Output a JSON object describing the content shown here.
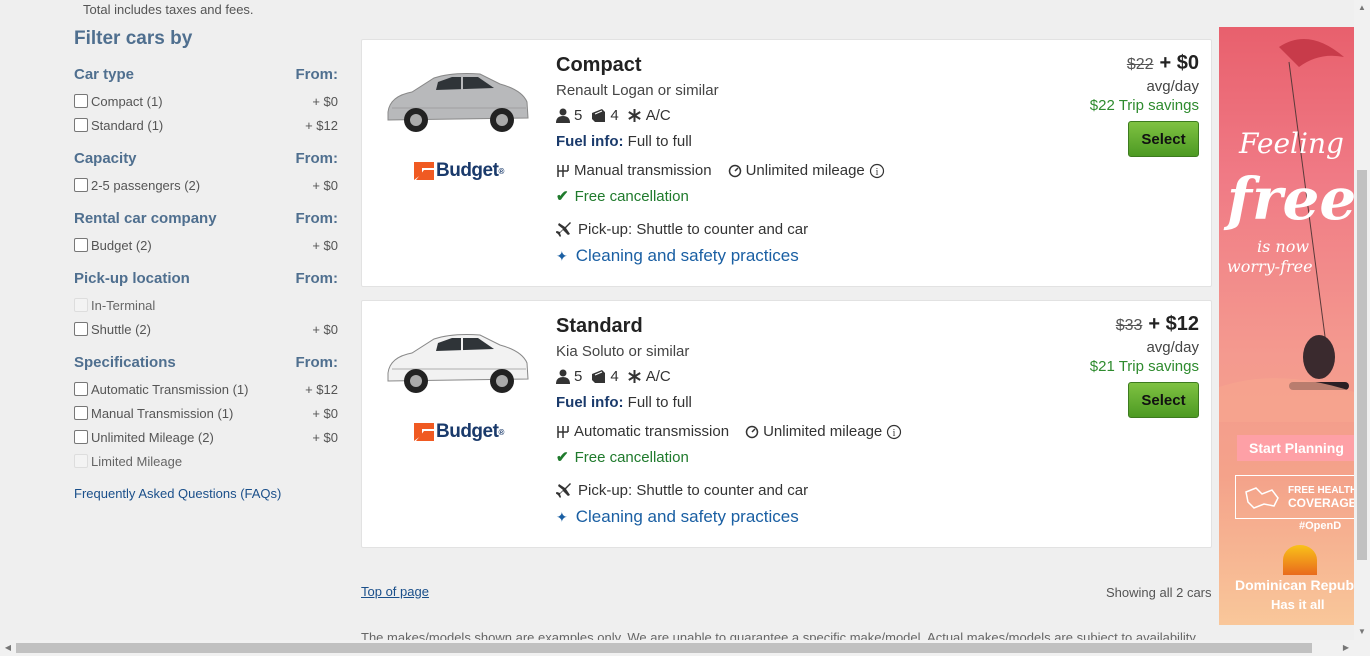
{
  "page": {
    "top_note": "Total includes taxes and fees.",
    "top_link": "Top of page",
    "showing": "Showing all 2 cars",
    "disclaimer": "The makes/models shown are examples only. We are unable to guarantee a specific make/model. Actual makes/models are subject to availability."
  },
  "sidebar": {
    "title": "Filter cars by",
    "faq": "Frequently Asked Questions (FAQs)",
    "groups": [
      {
        "label": "Car type",
        "from": "From:",
        "options": [
          {
            "label": "Compact (1)",
            "price": "+ $0"
          },
          {
            "label": "Standard (1)",
            "price": "+ $12"
          }
        ]
      },
      {
        "label": "Capacity",
        "from": "From:",
        "options": [
          {
            "label": "2-5 passengers (2)",
            "price": "+ $0"
          }
        ]
      },
      {
        "label": "Rental car company",
        "from": "From:",
        "options": [
          {
            "label": "Budget (2)",
            "price": "+ $0"
          }
        ]
      },
      {
        "label": "Pick-up location",
        "from": "From:",
        "options": [
          {
            "label": "In-Terminal",
            "price": ""
          },
          {
            "label": "Shuttle (2)",
            "price": "+ $0"
          }
        ]
      },
      {
        "label": "Specifications",
        "from": "From:",
        "options": [
          {
            "label": "Automatic Transmission (1)",
            "price": "+ $12"
          },
          {
            "label": "Manual Transmission (1)",
            "price": "+ $0"
          },
          {
            "label": "Unlimited Mileage (2)",
            "price": "+ $0"
          },
          {
            "label": "Limited Mileage",
            "price": ""
          }
        ]
      }
    ]
  },
  "cars": [
    {
      "category": "Compact",
      "model": "Renault Logan or similar",
      "passengers": "5",
      "bags": "4",
      "ac": "A/C",
      "fuel_label": "Fuel info:",
      "fuel_value": "Full to full",
      "transmission": "Manual transmission",
      "mileage": "Unlimited mileage",
      "cancellation": "Free cancellation",
      "pickup": "Pick-up: Shuttle to counter and car",
      "cleaning": "Cleaning and safety practices",
      "old_price": "$22",
      "new_price": "+ $0",
      "per": "avg/day",
      "savings": "$22 Trip savings",
      "select": "Select",
      "brand": "Budget",
      "car_color": "#b8b9bb"
    },
    {
      "category": "Standard",
      "model": "Kia Soluto or similar",
      "passengers": "5",
      "bags": "4",
      "ac": "A/C",
      "fuel_label": "Fuel info:",
      "fuel_value": "Full to full",
      "transmission": "Automatic transmission",
      "mileage": "Unlimited mileage",
      "cancellation": "Free cancellation",
      "pickup": "Pick-up: Shuttle to counter and car",
      "cleaning": "Cleaning and safety practices",
      "old_price": "$33",
      "new_price": "+ $12",
      "per": "avg/day",
      "savings": "$21 Trip savings",
      "select": "Select",
      "brand": "Budget",
      "car_color": "#f2f2f2"
    }
  ],
  "ad": {
    "line1": "Feeling",
    "line2": "free",
    "line3": "is now",
    "line4": "worry-free",
    "cta": "Start Planning",
    "coverage1": "FREE HEALTH",
    "coverage2": "COVERAGE",
    "hashtag": "#OpenD",
    "brand1": "Dominican Republ",
    "brand2": "Has it all"
  },
  "colors": {
    "accent_green": "#4d9a23",
    "link_blue": "#1a4f8a",
    "savings_green": "#2e8b2e",
    "budget_orange": "#f05a22",
    "budget_navy": "#1a3a6b"
  }
}
